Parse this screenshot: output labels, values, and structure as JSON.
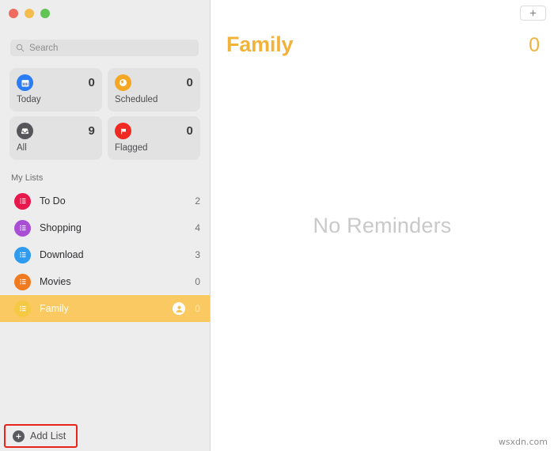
{
  "window": {
    "traffic_lights": [
      {
        "name": "close",
        "color": "#ef6b5f"
      },
      {
        "name": "minimize",
        "color": "#f5bd4f"
      },
      {
        "name": "maximize",
        "color": "#61c454"
      }
    ]
  },
  "sidebar": {
    "search": {
      "placeholder": "Search",
      "value": "",
      "icon": "search-icon"
    },
    "smart_cards": [
      {
        "label": "Today",
        "count": "0",
        "icon": "calendar-icon",
        "color": "#2b7cf6"
      },
      {
        "label": "Scheduled",
        "count": "0",
        "icon": "clock-icon",
        "color": "#f5a623"
      },
      {
        "label": "All",
        "count": "9",
        "icon": "inbox-icon",
        "color": "#56565a"
      },
      {
        "label": "Flagged",
        "count": "0",
        "icon": "flag-icon",
        "color": "#f02a22"
      }
    ],
    "mylists_header": "My Lists",
    "lists": [
      {
        "label": "To Do",
        "count": "2",
        "color": "#e8174c",
        "selected": false,
        "shared": false
      },
      {
        "label": "Shopping",
        "count": "4",
        "color": "#a94fd3",
        "selected": false,
        "shared": false
      },
      {
        "label": "Download",
        "count": "3",
        "color": "#2e9bef",
        "selected": false,
        "shared": false
      },
      {
        "label": "Movies",
        "count": "0",
        "color": "#ef7a20",
        "selected": false,
        "shared": false
      },
      {
        "label": "Family",
        "count": "0",
        "color": "#f5c944",
        "selected": true,
        "shared": true
      }
    ],
    "add_list": {
      "label": "Add List",
      "icon": "plus-circle-icon",
      "highlight_color": "#e8241c"
    }
  },
  "main": {
    "add_reminder_label": "+",
    "title": "Family",
    "count": "0",
    "empty_text": "No Reminders",
    "accent_color": "#f2b33c"
  },
  "watermark": "wsxdn.com"
}
